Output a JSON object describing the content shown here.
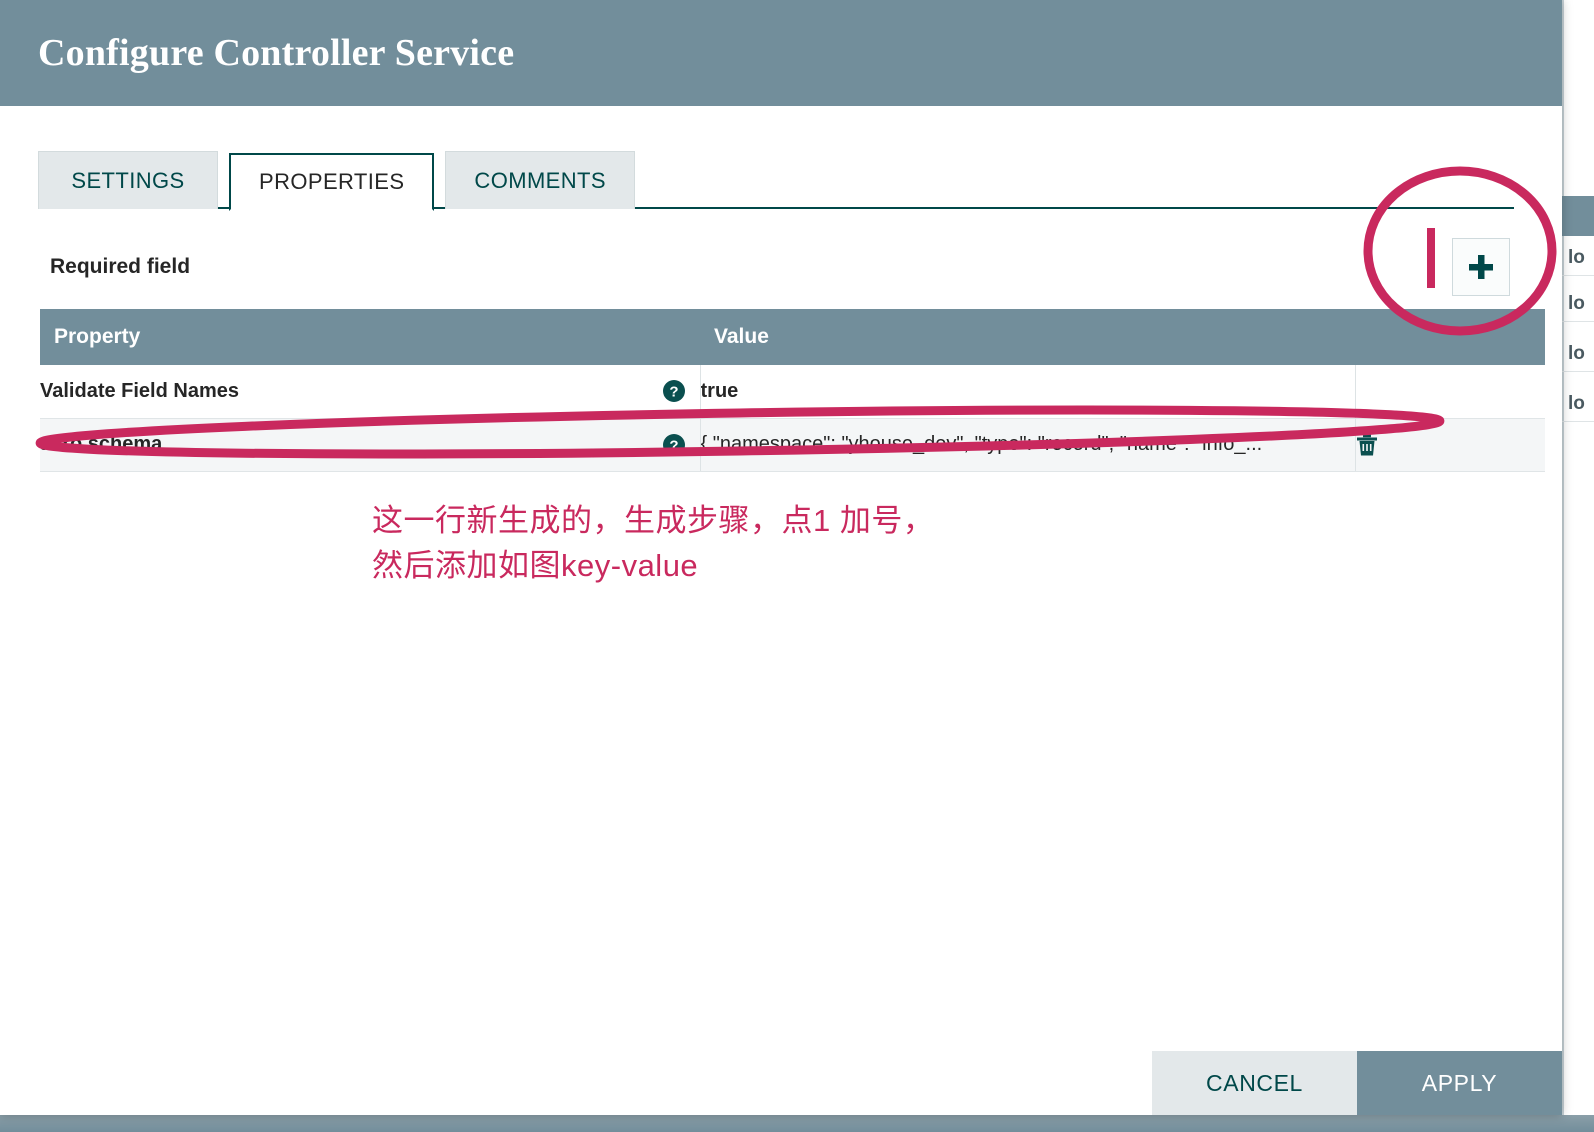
{
  "dialog": {
    "title": "Configure Controller Service",
    "tabs": [
      {
        "label": "SETTINGS",
        "active": false
      },
      {
        "label": "PROPERTIES",
        "active": true
      },
      {
        "label": "COMMENTS",
        "active": false
      }
    ],
    "required_field_label": "Required field",
    "add_button_icon": "plus-icon",
    "table": {
      "columns": [
        "Property",
        "Value",
        ""
      ],
      "rows": [
        {
          "property": "Validate Field Names",
          "help_icon": "help-circle-icon",
          "value": "true",
          "value_bold": true,
          "has_delete": false,
          "delete_icon": ""
        },
        {
          "property": "avro.schema",
          "help_icon": "help-circle-icon",
          "value": "{ \"namespace\": \"yhouse_dev\", \"type\": \"record\", \"name\": \"info_...",
          "value_bold": false,
          "has_delete": true,
          "delete_icon": "trash-icon"
        }
      ]
    },
    "footer": {
      "cancel_label": "CANCEL",
      "apply_label": "APPLY"
    }
  },
  "annotation": {
    "text": "这一行新生成的，生成步骤，点1 加号，\n然后添加如图key-value",
    "color": "#c9295e",
    "marks": [
      "ellipse-around-add-button",
      "digit-one-stroke",
      "ellipse-around-avro-row"
    ]
  },
  "background": {
    "right_panel_rows": [
      "lo",
      "lo",
      "lo",
      "lo"
    ]
  },
  "colors": {
    "header_bar": "#728e9b",
    "tab_active_border": "#004849",
    "tab_inactive_bg": "#e3e8ea",
    "table_header_bg": "#728e9b",
    "row_alt_bg": "#f4f6f7",
    "accent_teal": "#004849",
    "annotation_pink": "#c9295e",
    "apply_bg": "#728e9b",
    "cancel_bg": "#e3e8ea"
  }
}
